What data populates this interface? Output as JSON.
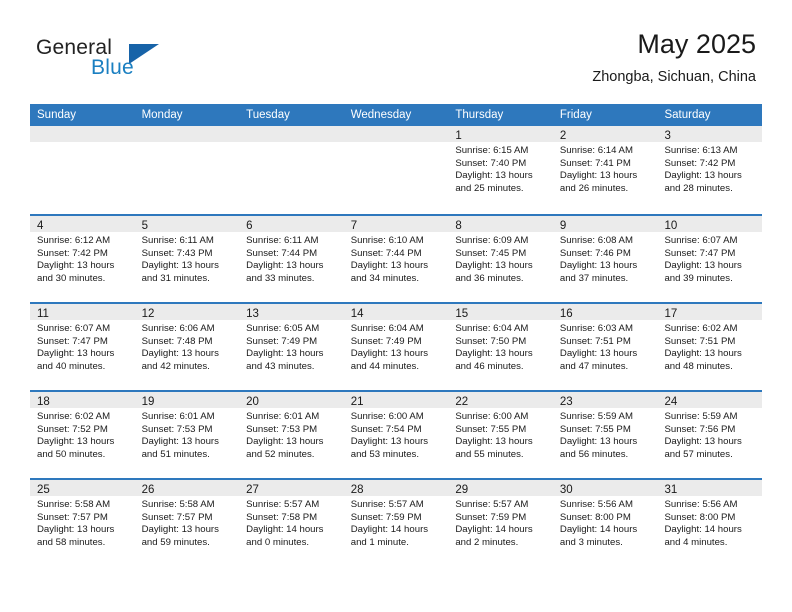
{
  "brand": {
    "line1": "General",
    "line2": "Blue",
    "icon": "triangle-logo",
    "color_dark": "#222222",
    "color_blue": "#1a7fc1"
  },
  "header": {
    "title": "May 2025",
    "subtitle": "Zhongba, Sichuan, China"
  },
  "theme": {
    "header_blue": "#2e78bd",
    "day_band_gray": "#ebebeb",
    "text": "#1a1a1a"
  },
  "weekdays": [
    "Sunday",
    "Monday",
    "Tuesday",
    "Wednesday",
    "Thursday",
    "Friday",
    "Saturday"
  ],
  "weeks": [
    [
      {
        "num": "",
        "sunrise": "",
        "sunset": "",
        "daylight1": "",
        "daylight2": ""
      },
      {
        "num": "",
        "sunrise": "",
        "sunset": "",
        "daylight1": "",
        "daylight2": ""
      },
      {
        "num": "",
        "sunrise": "",
        "sunset": "",
        "daylight1": "",
        "daylight2": ""
      },
      {
        "num": "",
        "sunrise": "",
        "sunset": "",
        "daylight1": "",
        "daylight2": ""
      },
      {
        "num": "1",
        "sunrise": "Sunrise: 6:15 AM",
        "sunset": "Sunset: 7:40 PM",
        "daylight1": "Daylight: 13 hours",
        "daylight2": "and 25 minutes."
      },
      {
        "num": "2",
        "sunrise": "Sunrise: 6:14 AM",
        "sunset": "Sunset: 7:41 PM",
        "daylight1": "Daylight: 13 hours",
        "daylight2": "and 26 minutes."
      },
      {
        "num": "3",
        "sunrise": "Sunrise: 6:13 AM",
        "sunset": "Sunset: 7:42 PM",
        "daylight1": "Daylight: 13 hours",
        "daylight2": "and 28 minutes."
      }
    ],
    [
      {
        "num": "4",
        "sunrise": "Sunrise: 6:12 AM",
        "sunset": "Sunset: 7:42 PM",
        "daylight1": "Daylight: 13 hours",
        "daylight2": "and 30 minutes."
      },
      {
        "num": "5",
        "sunrise": "Sunrise: 6:11 AM",
        "sunset": "Sunset: 7:43 PM",
        "daylight1": "Daylight: 13 hours",
        "daylight2": "and 31 minutes."
      },
      {
        "num": "6",
        "sunrise": "Sunrise: 6:11 AM",
        "sunset": "Sunset: 7:44 PM",
        "daylight1": "Daylight: 13 hours",
        "daylight2": "and 33 minutes."
      },
      {
        "num": "7",
        "sunrise": "Sunrise: 6:10 AM",
        "sunset": "Sunset: 7:44 PM",
        "daylight1": "Daylight: 13 hours",
        "daylight2": "and 34 minutes."
      },
      {
        "num": "8",
        "sunrise": "Sunrise: 6:09 AM",
        "sunset": "Sunset: 7:45 PM",
        "daylight1": "Daylight: 13 hours",
        "daylight2": "and 36 minutes."
      },
      {
        "num": "9",
        "sunrise": "Sunrise: 6:08 AM",
        "sunset": "Sunset: 7:46 PM",
        "daylight1": "Daylight: 13 hours",
        "daylight2": "and 37 minutes."
      },
      {
        "num": "10",
        "sunrise": "Sunrise: 6:07 AM",
        "sunset": "Sunset: 7:47 PM",
        "daylight1": "Daylight: 13 hours",
        "daylight2": "and 39 minutes."
      }
    ],
    [
      {
        "num": "11",
        "sunrise": "Sunrise: 6:07 AM",
        "sunset": "Sunset: 7:47 PM",
        "daylight1": "Daylight: 13 hours",
        "daylight2": "and 40 minutes."
      },
      {
        "num": "12",
        "sunrise": "Sunrise: 6:06 AM",
        "sunset": "Sunset: 7:48 PM",
        "daylight1": "Daylight: 13 hours",
        "daylight2": "and 42 minutes."
      },
      {
        "num": "13",
        "sunrise": "Sunrise: 6:05 AM",
        "sunset": "Sunset: 7:49 PM",
        "daylight1": "Daylight: 13 hours",
        "daylight2": "and 43 minutes."
      },
      {
        "num": "14",
        "sunrise": "Sunrise: 6:04 AM",
        "sunset": "Sunset: 7:49 PM",
        "daylight1": "Daylight: 13 hours",
        "daylight2": "and 44 minutes."
      },
      {
        "num": "15",
        "sunrise": "Sunrise: 6:04 AM",
        "sunset": "Sunset: 7:50 PM",
        "daylight1": "Daylight: 13 hours",
        "daylight2": "and 46 minutes."
      },
      {
        "num": "16",
        "sunrise": "Sunrise: 6:03 AM",
        "sunset": "Sunset: 7:51 PM",
        "daylight1": "Daylight: 13 hours",
        "daylight2": "and 47 minutes."
      },
      {
        "num": "17",
        "sunrise": "Sunrise: 6:02 AM",
        "sunset": "Sunset: 7:51 PM",
        "daylight1": "Daylight: 13 hours",
        "daylight2": "and 48 minutes."
      }
    ],
    [
      {
        "num": "18",
        "sunrise": "Sunrise: 6:02 AM",
        "sunset": "Sunset: 7:52 PM",
        "daylight1": "Daylight: 13 hours",
        "daylight2": "and 50 minutes."
      },
      {
        "num": "19",
        "sunrise": "Sunrise: 6:01 AM",
        "sunset": "Sunset: 7:53 PM",
        "daylight1": "Daylight: 13 hours",
        "daylight2": "and 51 minutes."
      },
      {
        "num": "20",
        "sunrise": "Sunrise: 6:01 AM",
        "sunset": "Sunset: 7:53 PM",
        "daylight1": "Daylight: 13 hours",
        "daylight2": "and 52 minutes."
      },
      {
        "num": "21",
        "sunrise": "Sunrise: 6:00 AM",
        "sunset": "Sunset: 7:54 PM",
        "daylight1": "Daylight: 13 hours",
        "daylight2": "and 53 minutes."
      },
      {
        "num": "22",
        "sunrise": "Sunrise: 6:00 AM",
        "sunset": "Sunset: 7:55 PM",
        "daylight1": "Daylight: 13 hours",
        "daylight2": "and 55 minutes."
      },
      {
        "num": "23",
        "sunrise": "Sunrise: 5:59 AM",
        "sunset": "Sunset: 7:55 PM",
        "daylight1": "Daylight: 13 hours",
        "daylight2": "and 56 minutes."
      },
      {
        "num": "24",
        "sunrise": "Sunrise: 5:59 AM",
        "sunset": "Sunset: 7:56 PM",
        "daylight1": "Daylight: 13 hours",
        "daylight2": "and 57 minutes."
      }
    ],
    [
      {
        "num": "25",
        "sunrise": "Sunrise: 5:58 AM",
        "sunset": "Sunset: 7:57 PM",
        "daylight1": "Daylight: 13 hours",
        "daylight2": "and 58 minutes."
      },
      {
        "num": "26",
        "sunrise": "Sunrise: 5:58 AM",
        "sunset": "Sunset: 7:57 PM",
        "daylight1": "Daylight: 13 hours",
        "daylight2": "and 59 minutes."
      },
      {
        "num": "27",
        "sunrise": "Sunrise: 5:57 AM",
        "sunset": "Sunset: 7:58 PM",
        "daylight1": "Daylight: 14 hours",
        "daylight2": "and 0 minutes."
      },
      {
        "num": "28",
        "sunrise": "Sunrise: 5:57 AM",
        "sunset": "Sunset: 7:59 PM",
        "daylight1": "Daylight: 14 hours",
        "daylight2": "and 1 minute."
      },
      {
        "num": "29",
        "sunrise": "Sunrise: 5:57 AM",
        "sunset": "Sunset: 7:59 PM",
        "daylight1": "Daylight: 14 hours",
        "daylight2": "and 2 minutes."
      },
      {
        "num": "30",
        "sunrise": "Sunrise: 5:56 AM",
        "sunset": "Sunset: 8:00 PM",
        "daylight1": "Daylight: 14 hours",
        "daylight2": "and 3 minutes."
      },
      {
        "num": "31",
        "sunrise": "Sunrise: 5:56 AM",
        "sunset": "Sunset: 8:00 PM",
        "daylight1": "Daylight: 14 hours",
        "daylight2": "and 4 minutes."
      }
    ]
  ]
}
